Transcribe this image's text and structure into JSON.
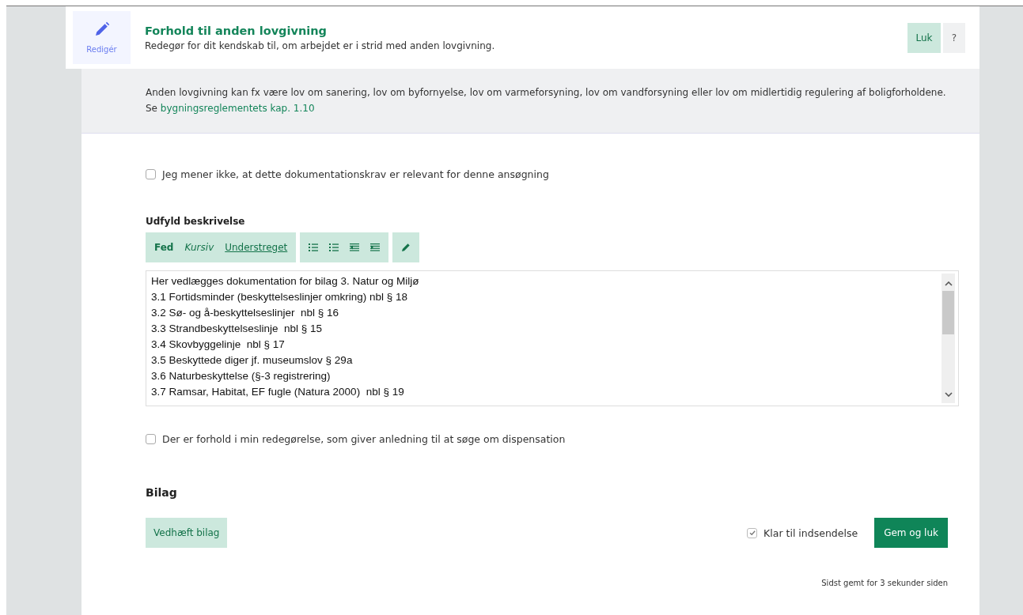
{
  "header": {
    "edit_label": "Redigér",
    "title": "Forhold til anden lovgivning",
    "subtitle": "Redegør for dit kendskab til, om arbejdet er i strid med anden lovgivning.",
    "buttons": [
      {
        "kind": "close",
        "label": "Luk"
      },
      {
        "kind": "help",
        "label": "?"
      }
    ]
  },
  "info": {
    "text": "Anden lovgivning kan fx være lov om sanering, lov om byfornyelse, lov om varmeforsyning, lov om vandforsyning eller lov om midlertidig regulering af boligforholdene.",
    "link_prefix": "Se",
    "link": "bygningsreglementets kap. 1.10"
  },
  "not_relevant": {
    "label": "Jeg mener ikke, at dette dokumentationskrav er relevant for denne ansøgning",
    "checked": false
  },
  "description": {
    "label": "Udfyld beskrivelse",
    "toolbar_groups": [
      [
        {
          "kind": "bold",
          "label": "Fed"
        },
        {
          "kind": "italic",
          "label": "Kursiv"
        },
        {
          "kind": "underline",
          "label": "Understreget"
        }
      ],
      [
        {
          "kind": "bullets"
        },
        {
          "kind": "numbers"
        },
        {
          "kind": "outdent"
        },
        {
          "kind": "indent"
        }
      ],
      [
        {
          "kind": "pencil"
        }
      ]
    ],
    "lines": [
      "Her vedlægges dokumentation for bilag 3. Natur og Miljø",
      "3.1 Fortidsminder (beskyttelseslinjer omkring) nbl § 18",
      "3.2 Sø- og å-beskyttelseslinjer  nbl § 16",
      "3.3 Strandbeskyttelseslinje  nbl § 15",
      "3.4 Skovbyggelinje  nbl § 17",
      "3.5 Beskyttede diger jf. museumslov § 29a",
      "3.6 Naturbeskyttelse (§-3 registrering)",
      "3.7 Ramsar, Habitat, EF fugle (Natura 2000)  nbl § 19"
    ]
  },
  "dispensation": {
    "label": "Der er forhold i min redegørelse, som giver anledning til at søge om dispensation",
    "checked": false
  },
  "attachments": {
    "heading": "Bilag",
    "attach_button": "Vedhæft bilag"
  },
  "ready": {
    "label": "Klar til indsendelse",
    "checked": true
  },
  "save_button": "Gem og luk",
  "status": "Sidst gemt for 3 sekunder siden"
}
